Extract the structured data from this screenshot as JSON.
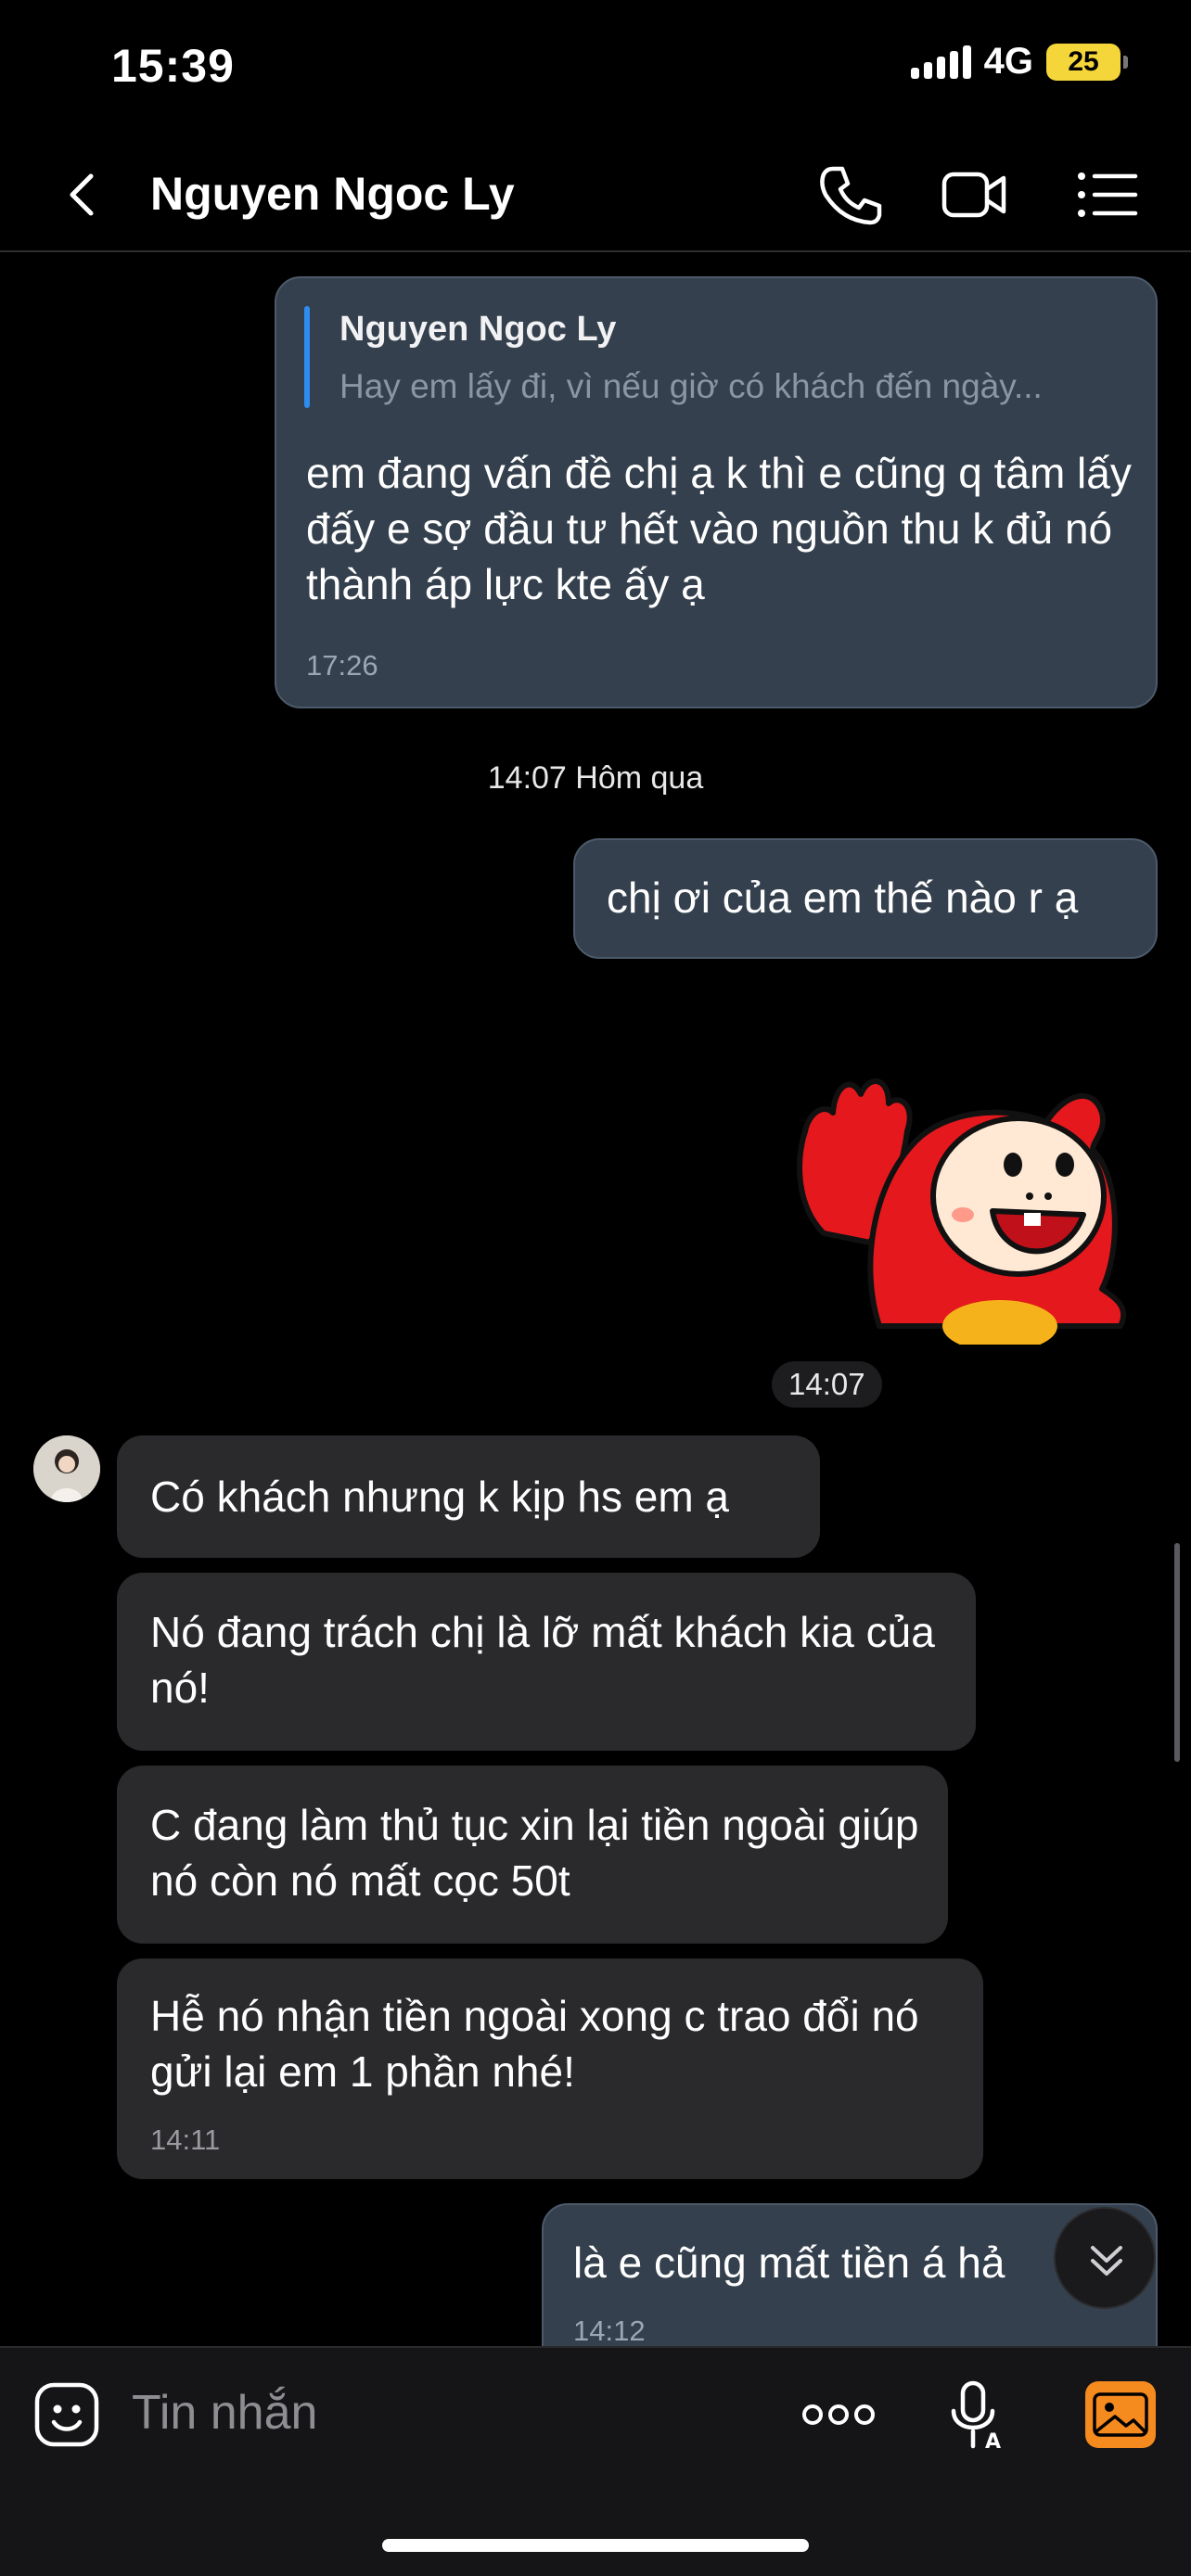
{
  "status": {
    "time": "15:39",
    "network": "4G",
    "battery": "25"
  },
  "header": {
    "title": "Nguyen Ngoc Ly"
  },
  "messages": {
    "quoted": {
      "author": "Nguyen Ngoc Ly",
      "snippet": "Hay em lấy đi, vì nếu giờ có khách đến ngày...",
      "text": "em đang vấn đề chị ạ k thì e cũng q tâm lấy đấy e sợ đầu tư hết vào nguồn thu k đủ nó thành áp lực kte ấy ạ",
      "time": "17:26"
    },
    "divider": "14:07 Hôm qua",
    "out1": "chị ơi của em thế nào r ạ",
    "sticker_time": "14:07",
    "in1": "Có khách nhưng k kịp hs em ạ",
    "in2": "Nó đang trách chị là lỡ mất khách kia của nó!",
    "in3": "C đang làm thủ tục xin lại tiền ngoài giúp nó còn nó mất cọc 50t",
    "in4": "Hễ nó nhận tiền ngoài xong c trao đổi nó gửi lại em 1 phần nhé!",
    "in4_time": "14:11",
    "out2": "là e cũng mất tiền á hả",
    "out2_time": "14:12"
  },
  "input": {
    "placeholder": "Tin nhắn"
  },
  "colors": {
    "accent": "#2e8cf0",
    "outgoing_bubble": "#34404d",
    "incoming_bubble": "#2a2a2d",
    "battery": "#f5d63a"
  },
  "icons": [
    "back-chevron-icon",
    "phone-icon",
    "video-call-icon",
    "menu-list-icon",
    "sticker-emoji-icon",
    "more-dots-icon",
    "voice-mic-icon",
    "gallery-image-icon",
    "scroll-down-icon"
  ]
}
